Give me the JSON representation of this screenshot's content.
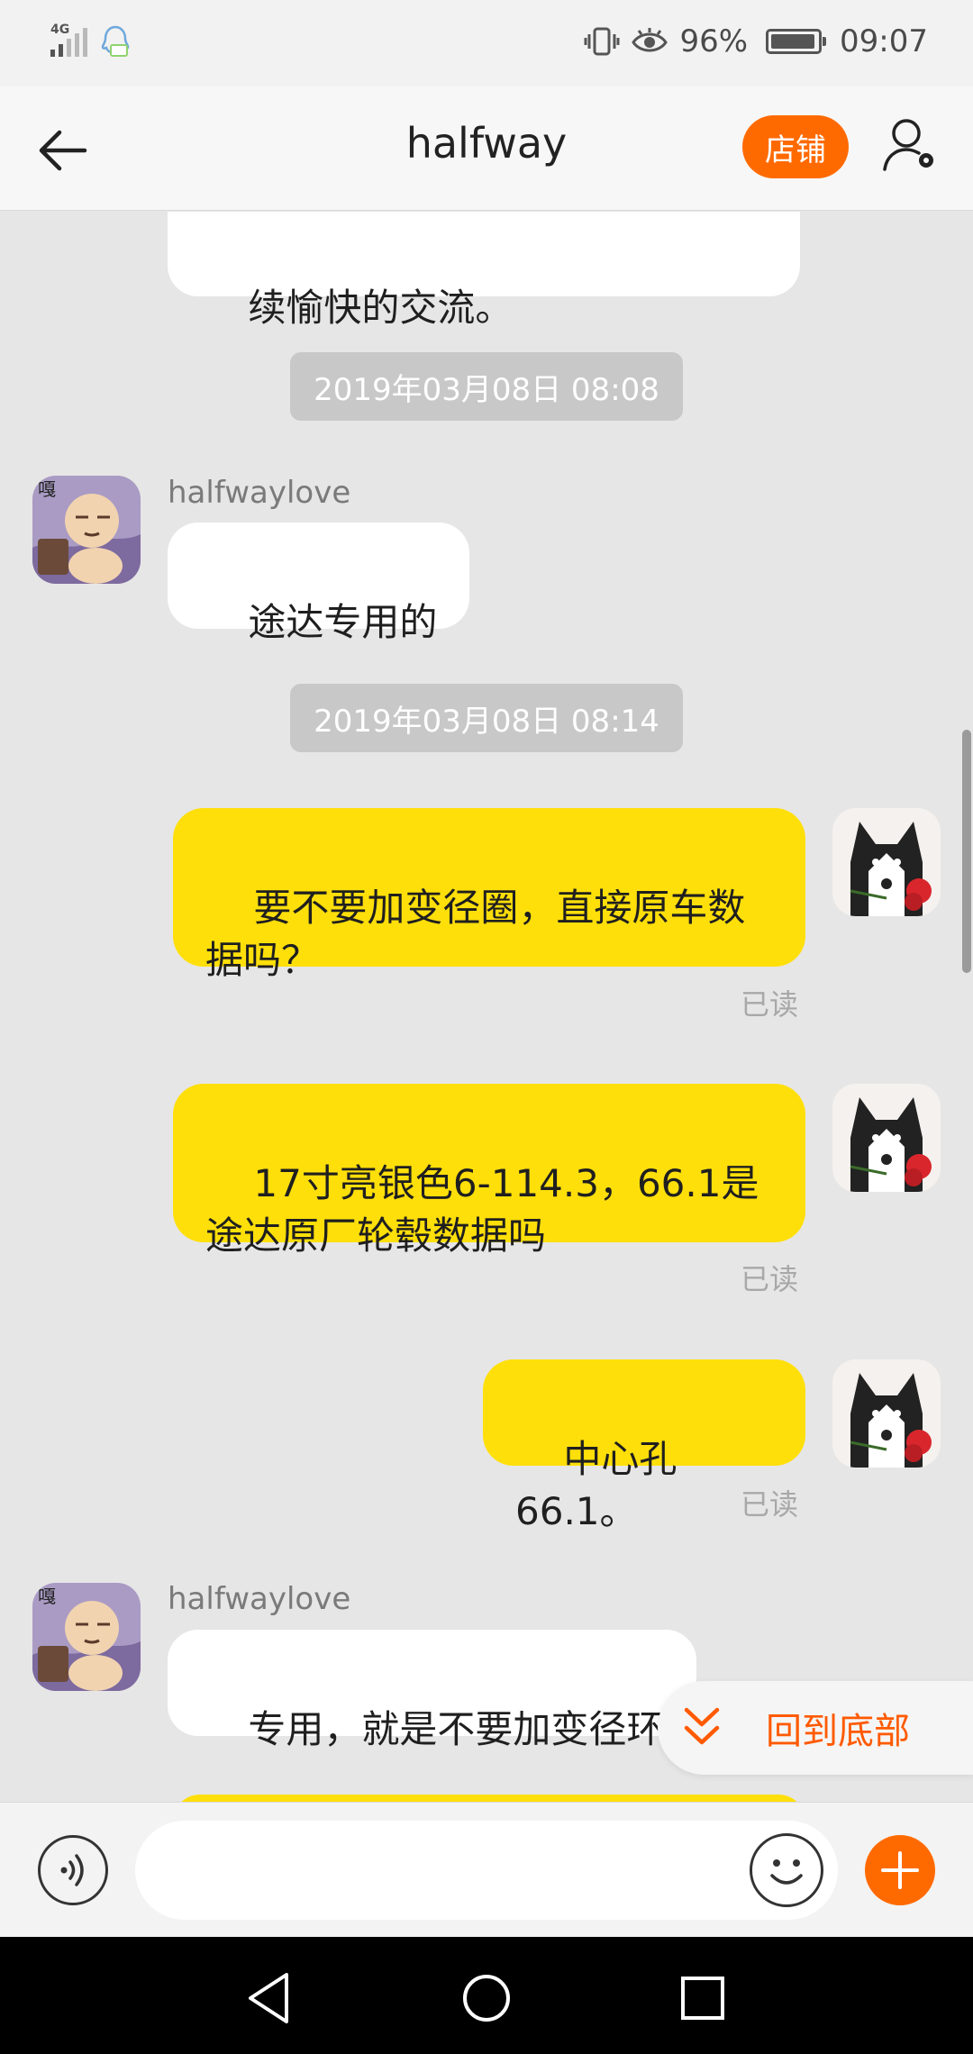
{
  "status_bar": {
    "network": "4G",
    "battery_percent": "96%",
    "time": "09:07",
    "battery_level": 0.96,
    "icons": [
      "signal-icon",
      "qq-notification-icon",
      "vibrate-icon",
      "eye-comfort-icon",
      "battery-icon"
    ]
  },
  "header": {
    "title": "halfway",
    "shop_label": "店铺",
    "icons": [
      "back-arrow-icon",
      "user-settings-icon"
    ]
  },
  "messages": {
    "partial_text": "续愉快的交流。",
    "ts1": "2019年03月08日 08:08",
    "sender1": "halfwaylove",
    "in1": "途达专用的",
    "ts2": "2019年03月08日 08:14",
    "out1": "要不要加变径圈，直接原车数\n据吗？",
    "read1": "已读",
    "out2": "17寸亮银色6-114.3，66.1是\n途达原厂轮毂数据吗",
    "read2": "已读",
    "out3": "中心孔66.1。",
    "read3": "已读",
    "sender2": "halfwaylove",
    "in2": "专用，就是不要加变径环"
  },
  "back_to_bottom": {
    "label": "回到底部"
  },
  "input_bar": {
    "text_value": "",
    "icons": [
      "voice-icon",
      "emoji-icon",
      "plus-icon"
    ]
  },
  "colors": {
    "accent": "#ff6a00",
    "outgoing_bubble": "#ffdf0a",
    "incoming_bubble": "#ffffff",
    "background": "#e6e6e6"
  }
}
